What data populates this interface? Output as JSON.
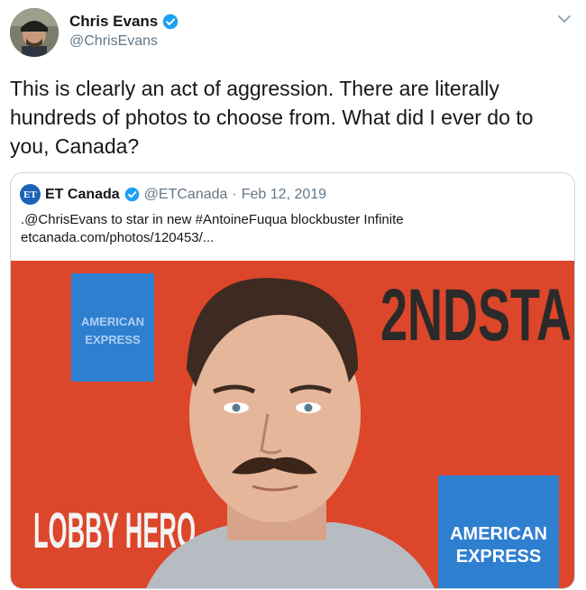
{
  "tweet": {
    "author_name": "Chris Evans",
    "author_handle": "@ChrisEvans",
    "text": "This is clearly an act of aggression. There are literally hundreds of photos to choose from. What did I ever do to you, Canada?"
  },
  "quoted_tweet": {
    "logo_text": "ET",
    "author_name": "ET Canada",
    "author_handle": "@ETCanada",
    "separator": "·",
    "date": "Feb 12, 2019",
    "text_line1": ".@ChrisEvans to star in new #AntoineFuqua blockbuster Infinite",
    "text_line2": "etcanada.com/photos/120453/...",
    "photo": {
      "banner_top_right": "2NDSTA",
      "banner_left": "LOBBY HERO",
      "amex_line1": "AMERICAN",
      "amex_line2": "EXPRESS"
    }
  },
  "colors": {
    "verified": "#1da1f2",
    "backdrop": "#e34b2e",
    "amex_blue": "#2f7fd1"
  },
  "icons": [
    "verified-badge-icon",
    "chevron-down-icon"
  ]
}
